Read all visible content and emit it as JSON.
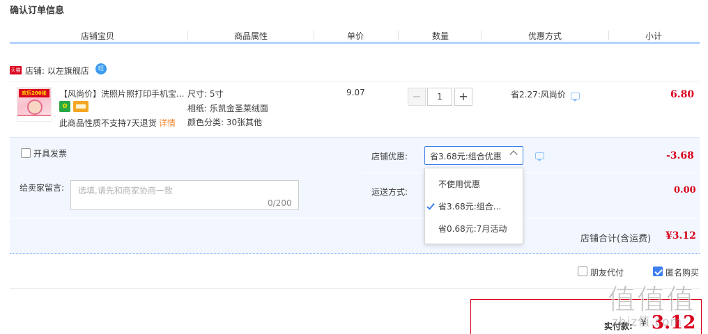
{
  "page": {
    "title": "确认订单信息"
  },
  "columns": [
    "店铺宝贝",
    "商品属性",
    "单价",
    "数量",
    "优惠方式",
    "小计"
  ],
  "shop": {
    "badge": "天猫",
    "label": "店铺: 以左旗舰店",
    "ww_icon": "wangwang-icon"
  },
  "item": {
    "thumb_badge": "欢乐200张",
    "name": "【风尚价】洗照片照打印手机宝...",
    "service_icon": "jingxuan-icon",
    "card_icon": "card-icon",
    "no_refund": "此商品性质不支持7天退货",
    "detail_link": "详情",
    "attrs": [
      "尺寸: 5寸",
      "相纸: 乐凯金圣莱绒面",
      "颜色分类: 30张其他"
    ],
    "price": "9.07",
    "qty_minus": "−",
    "qty": "1",
    "qty_plus": "+",
    "promo": "省2.27:风尚价",
    "subtotal": "6.80"
  },
  "options": {
    "invoice_label": "开具发票",
    "memo_label": "给卖家留言:",
    "memo_placeholder": "选填,请先和商家协商一致",
    "memo_count": "0/200",
    "shop_discount_label": "店铺优惠:",
    "shop_discount_selected": "省3.68元:组合优惠",
    "shop_discount_amount": "-3.68",
    "shipping_label": "运送方式:",
    "shipping_amount": "0.00",
    "dropdown": [
      "不使用优惠",
      "省3.68元:组合...",
      "省0.68元:7月活动"
    ],
    "shop_total_label": "店铺合计(含运费)",
    "shop_total": "¥3.12"
  },
  "footer": {
    "friend_pay": "朋友代付",
    "anonymous": "匿名购买",
    "final_label": "实付款:",
    "currency": "¥",
    "final_amount": "3.12"
  },
  "watermark": {
    "main": "值值值",
    "sub": "zhiz值.com"
  },
  "colors": {
    "accent": "#d9001b",
    "blue": "#3d7eef",
    "header_line": "#b2d1ff",
    "options_bg": "#f2f7ff"
  }
}
